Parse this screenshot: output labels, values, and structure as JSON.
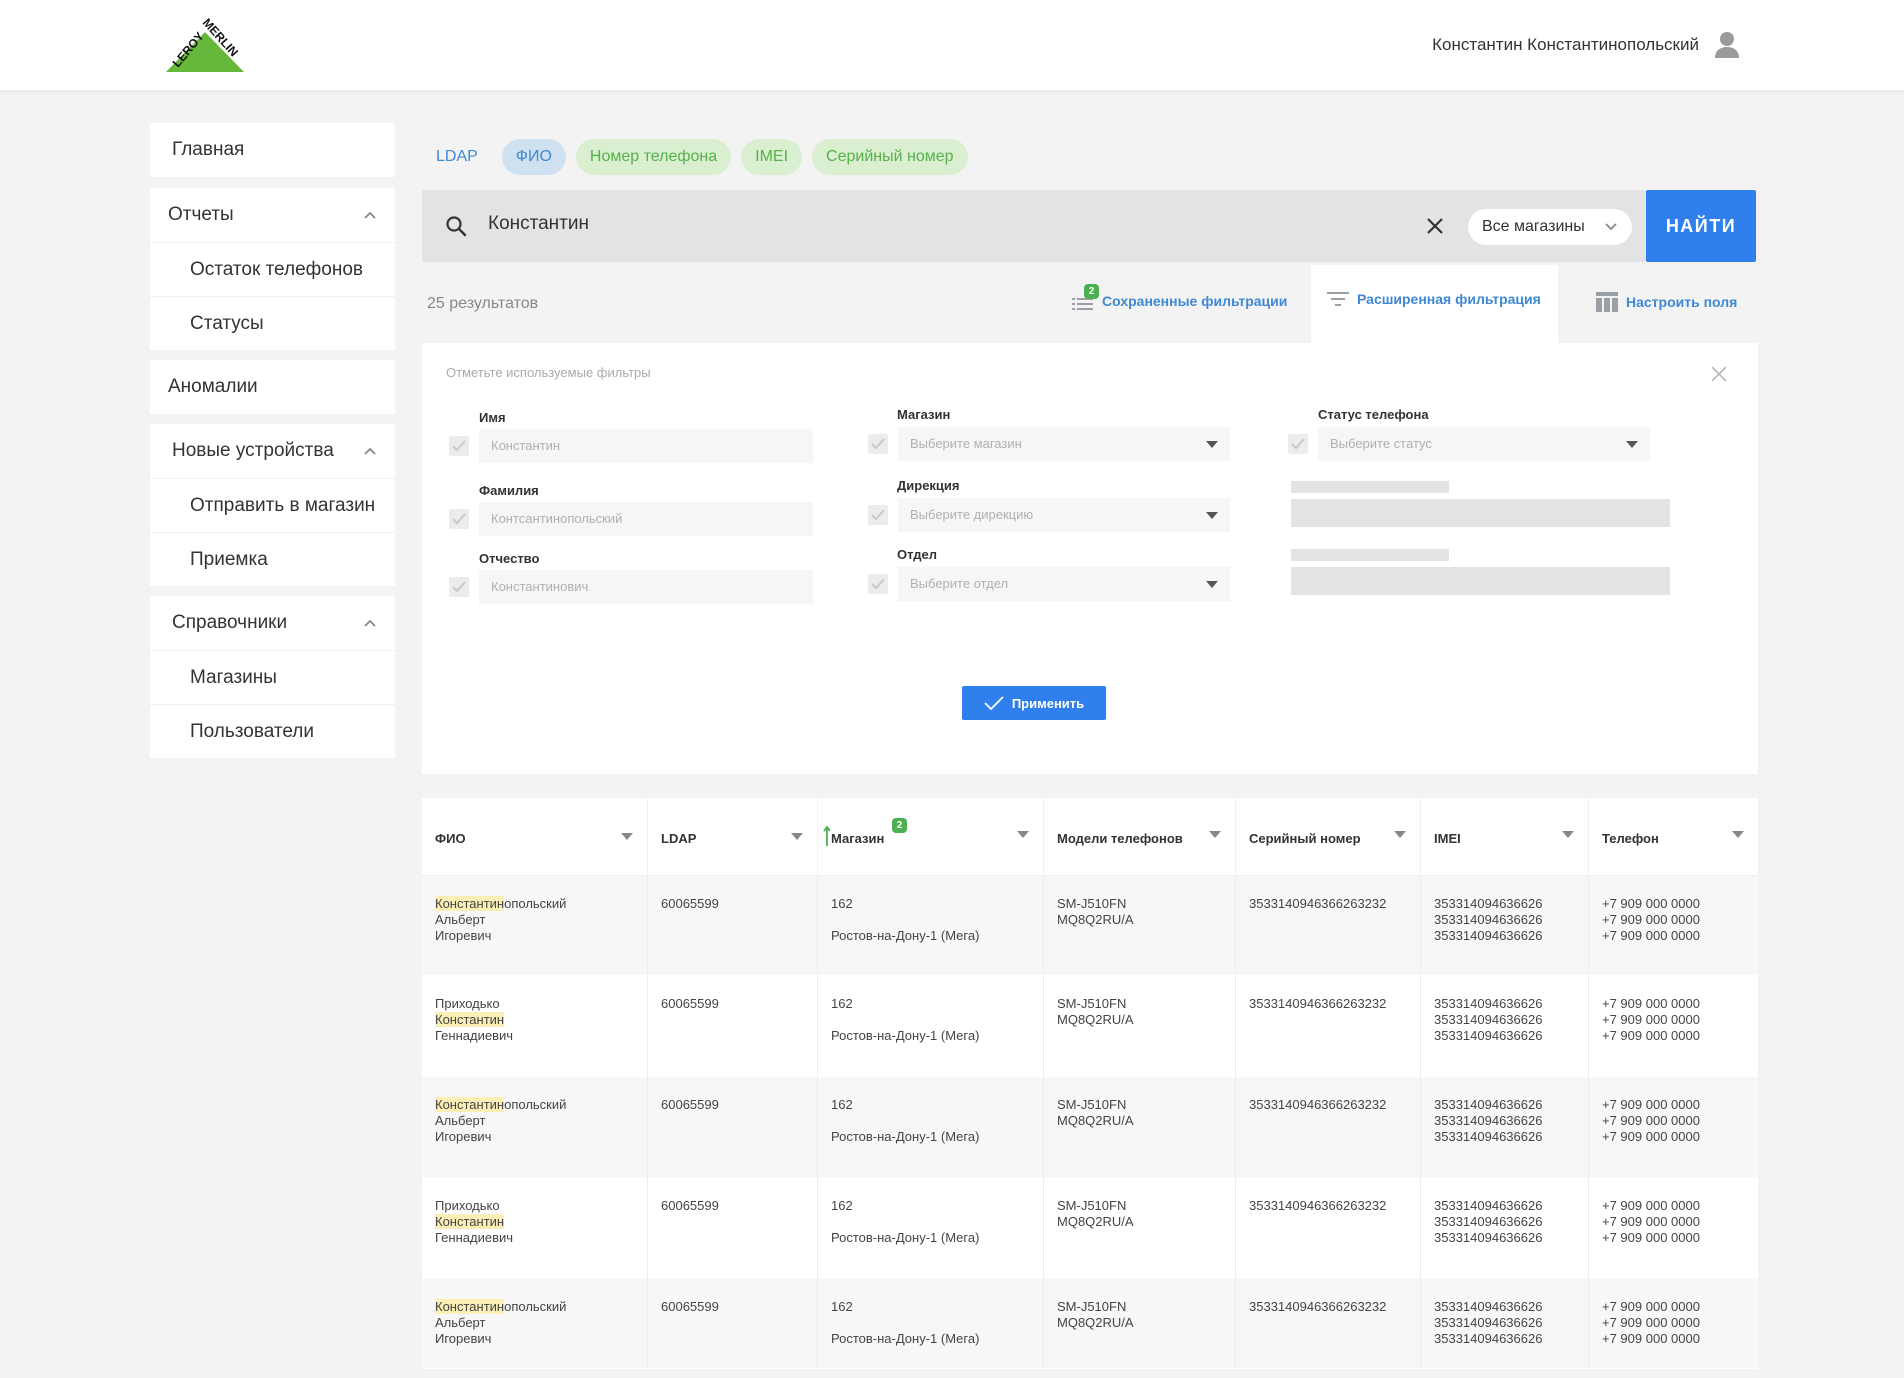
{
  "header": {
    "brand_top": "LEROY",
    "brand_bottom": "MERLIN",
    "user_name": "Константин Константинопольский"
  },
  "sidebar": {
    "home": "Главная",
    "reports": "Отчеты",
    "reports_items": [
      "Остаток телефонов",
      "Статусы"
    ],
    "anomalies": "Аномалии",
    "new_devices": "Новые устройства",
    "new_devices_items": [
      "Отправить в магазин",
      "Приемка"
    ],
    "references": "Справочники",
    "references_items": [
      "Магазины",
      "Пользователи"
    ]
  },
  "search_tabs": [
    "LDAP",
    "ФИО",
    "Номер телефона",
    "IMEI",
    "Серийный номер"
  ],
  "search": {
    "query": "Константин",
    "store_select": "Все магазины",
    "find_label": "НАЙТИ"
  },
  "toolbar": {
    "results": "25 результатов",
    "saved_filters": "Сохраненные фильтрации",
    "saved_count": "2",
    "advanced_filter": "Расширенная фильтрация",
    "configure_fields": "Настроить поля"
  },
  "filters": {
    "title": "Отметьте используемые фильтры",
    "first_name_label": "Имя",
    "first_name_value": "Константин",
    "last_name_label": "Фамилия",
    "last_name_value": "Контсантинопольский",
    "patronymic_label": "Отчество",
    "patronymic_value": "Константинович",
    "store_label": "Магазин",
    "store_placeholder": "Выберите магазин",
    "direction_label": "Дирекция",
    "direction_placeholder": "Выберите дирекцию",
    "department_label": "Отдел",
    "department_placeholder": "Выберите отдел",
    "status_label": "Статус телефона",
    "status_placeholder": "Выберите статус",
    "apply_label": "Применить"
  },
  "table": {
    "columns": [
      "ФИО",
      "LDAP",
      "Магазин",
      "Модели телефонов",
      "Серийный номер",
      "IMEI",
      "Телефон"
    ],
    "store_sort_badge": "2",
    "rows": [
      {
        "fio_pre": "",
        "fio_hl": "Константин",
        "fio_post": "опольский",
        "fio_line2": "Альберт",
        "fio_line3": "Игоревич",
        "ldap": "60065599",
        "store_num": "162",
        "store_name": "Ростов-на-Дону-1 (Мега)",
        "model1": "SM-J510FN",
        "model2": "MQ8Q2RU/A",
        "serial": "3533140946366263232",
        "imei": [
          "353314094636626",
          "353314094636626",
          "353314094636626"
        ],
        "phones": [
          "+7 909 000 0000",
          "+7 909 000 0000",
          "+7 909 000 0000"
        ]
      },
      {
        "fio_line1": "Приходько",
        "fio_hl": "Константин",
        "fio_line3": "Геннадиевич",
        "ldap": "60065599",
        "store_num": "162",
        "store_name": "Ростов-на-Дону-1 (Мега)",
        "model1": "SM-J510FN",
        "model2": "MQ8Q2RU/A",
        "serial": "3533140946366263232",
        "imei": [
          "353314094636626",
          "353314094636626",
          "353314094636626"
        ],
        "phones": [
          "+7 909 000 0000",
          "+7 909 000 0000",
          "+7 909 000 0000"
        ]
      },
      {
        "fio_pre": "",
        "fio_hl": "Константин",
        "fio_post": "опольский",
        "fio_line2": "Альберт",
        "fio_line3": "Игоревич",
        "ldap": "60065599",
        "store_num": "162",
        "store_name": "Ростов-на-Дону-1 (Мега)",
        "model1": "SM-J510FN",
        "model2": "MQ8Q2RU/A",
        "serial": "3533140946366263232",
        "imei": [
          "353314094636626",
          "353314094636626",
          "353314094636626"
        ],
        "phones": [
          "+7 909 000 0000",
          "+7 909 000 0000",
          "+7 909 000 0000"
        ]
      },
      {
        "fio_line1": "Приходько",
        "fio_hl": "Константин",
        "fio_line3": "Геннадиевич",
        "ldap": "60065599",
        "store_num": "162",
        "store_name": "Ростов-на-Дону-1 (Мега)",
        "model1": "SM-J510FN",
        "model2": "MQ8Q2RU/A",
        "serial": "3533140946366263232",
        "imei": [
          "353314094636626",
          "353314094636626",
          "353314094636626"
        ],
        "phones": [
          "+7 909 000 0000",
          "+7 909 000 0000",
          "+7 909 000 0000"
        ]
      },
      {
        "fio_pre": "",
        "fio_hl": "Константин",
        "fio_post": "опольский",
        "fio_line2": "Альберт",
        "fio_line3": "Игоревич",
        "ldap": "60065599",
        "store_num": "162",
        "store_name": "Ростов-на-Дону-1 (Мега)",
        "model1": "SM-J510FN",
        "model2": "MQ8Q2RU/A",
        "serial": "3533140946366263232",
        "imei": [
          "353314094636626",
          "353314094636626",
          "353314094636626"
        ],
        "phones": [
          "+7 909 000 0000",
          "+7 909 000 0000",
          "+7 909 000 0000"
        ]
      }
    ]
  }
}
